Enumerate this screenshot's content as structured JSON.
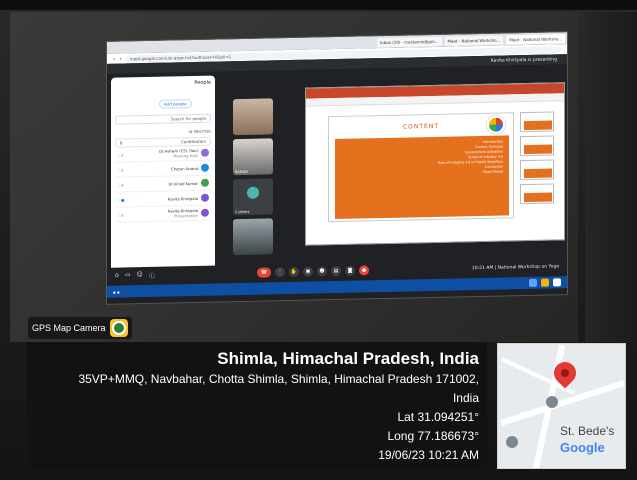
{
  "browser": {
    "tabs": [
      "Inbox (10) - rcestamin@gm...",
      "Meet - National Worksho...",
      "Meet - National Worksho..."
    ],
    "url": "meet.google.com/ubi-qrpw-hct?authuser=0&pli=1",
    "presenting_banner": "Kavita Khirtpala is presenting"
  },
  "people_panel": {
    "title": "People",
    "add_people": "Add people",
    "search_placeholder": "Search for people",
    "in_meeting": "IN MEETING",
    "contributors_label": "Contributors",
    "contributors_count": "6",
    "members": [
      {
        "name": "Dr.Ashwin (CS) (You)",
        "sub": "Meeting host"
      },
      {
        "name": "Chetan Anand",
        "sub": ""
      },
      {
        "name": "Dr.Vinod Kumar",
        "sub": ""
      },
      {
        "name": "Kavita Khirtpala",
        "sub": ""
      },
      {
        "name": "Kavita Khirtpala",
        "sub": "Presentation"
      }
    ]
  },
  "tiles": [
    {
      "label": ""
    },
    {
      "label": "RAMAN"
    },
    {
      "label": "2 others"
    },
    {
      "label": ""
    }
  ],
  "slide": {
    "heading": "CONTENT",
    "lines": [
      "Introduction",
      "Current Scenario",
      "Government Initiatives",
      "Scope of Industry 4.0",
      "Role of Industry 4.0 in Digital Swasthya",
      "Conclusion",
      "Road Ahead"
    ]
  },
  "meeting_bar": {
    "time_title": "10:21 AM | National Workshop on Yoga"
  },
  "gps": {
    "tag": "GPS Map Camera",
    "place": "Shimla, Himachal Pradesh, India",
    "address_line1": "35VP+MMQ, Navbahar, Chotta Shimla, Shimla, Himachal Pradesh 171002,",
    "address_line2": "India",
    "lat": "Lat 31.094251°",
    "long": "Long 77.186673°",
    "datetime": "19/06/23 10:21 AM"
  },
  "map": {
    "label": "St. Bede's",
    "brand": "Google"
  }
}
